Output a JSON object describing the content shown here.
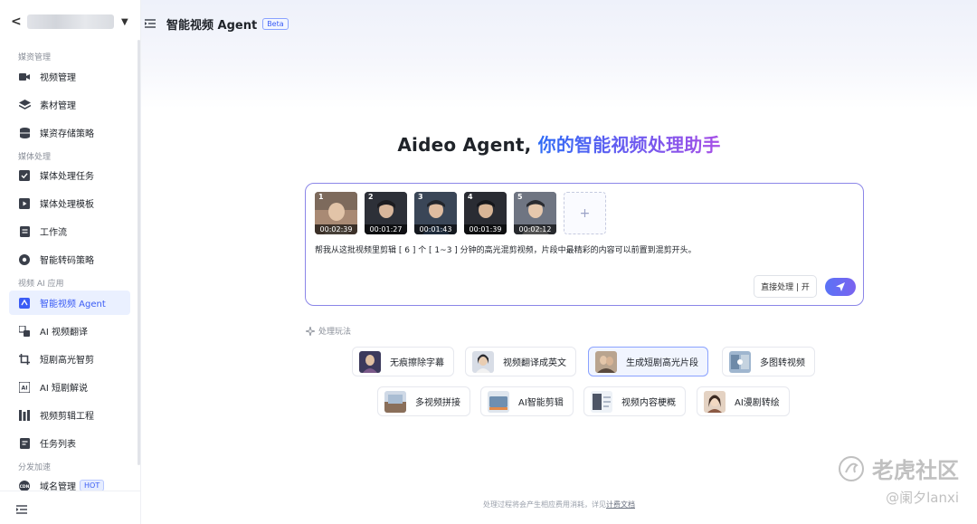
{
  "app": {
    "page_title": "智能视频 Agent",
    "beta_badge": "Beta"
  },
  "sidebar": {
    "groups": [
      "媒资管理",
      "媒体处理",
      "视频 AI 应用",
      "分发加速"
    ],
    "items": [
      {
        "label": "视频管理",
        "icon": "video-icon"
      },
      {
        "label": "素材管理",
        "icon": "layers-icon"
      },
      {
        "label": "媒资存储策略",
        "icon": "database-icon"
      },
      {
        "label": "媒体处理任务",
        "icon": "checkbox-icon"
      },
      {
        "label": "媒体处理模板",
        "icon": "play-square-icon"
      },
      {
        "label": "工作流",
        "icon": "document-icon"
      },
      {
        "label": "智能转码策略",
        "icon": "transcode-icon"
      },
      {
        "label": "智能视频 Agent",
        "icon": "agent-icon",
        "active": true
      },
      {
        "label": "AI 视频翻译",
        "icon": "translate-icon"
      },
      {
        "label": "短剧高光智剪",
        "icon": "crop-icon"
      },
      {
        "label": "AI 短剧解说",
        "icon": "ai-icon"
      },
      {
        "label": "视频剪辑工程",
        "icon": "edit-icon"
      },
      {
        "label": "任务列表",
        "icon": "list-icon"
      },
      {
        "label": "域名管理",
        "icon": "cdn-icon",
        "badge": "HOT"
      }
    ]
  },
  "hero": {
    "title_plain": "Aideo Agent, ",
    "title_highlight": "你的智能视频处理助手"
  },
  "chat": {
    "thumbnails": [
      {
        "num": "1",
        "duration": "00:02:39"
      },
      {
        "num": "2",
        "duration": "00:01:27"
      },
      {
        "num": "3",
        "duration": "00:01:43"
      },
      {
        "num": "4",
        "duration": "00:01:39"
      },
      {
        "num": "5",
        "duration": "00:02:12"
      }
    ],
    "add_symbol": "+",
    "prompt": "帮我从这批视频里剪辑 [ 6 ] 个 [ 1~3 ] 分钟的高光混剪视频，片段中最精彩的内容可以前置到混剪开头。",
    "direct_toggle": "直接处理 | 开"
  },
  "modes": {
    "label": "处理玩法",
    "chips": [
      {
        "label": "无痕擦除字幕"
      },
      {
        "label": "视频翻译成英文"
      },
      {
        "label": "生成短剧高光片段",
        "active": true
      },
      {
        "label": "多图转视频"
      },
      {
        "label": "多视频拼接"
      },
      {
        "label": "AI智能剪辑"
      },
      {
        "label": "视频内容梗概"
      },
      {
        "label": "AI漫剧转绘"
      }
    ]
  },
  "footer": {
    "text": "处理过程将会产生相应费用消耗，详见",
    "link": "计费文档"
  },
  "watermark": {
    "line1": "老虎社区",
    "line2": "@阑夕lanxi"
  },
  "colors": {
    "accent": "#3a5cf5",
    "border_active": "#8b86e8"
  }
}
